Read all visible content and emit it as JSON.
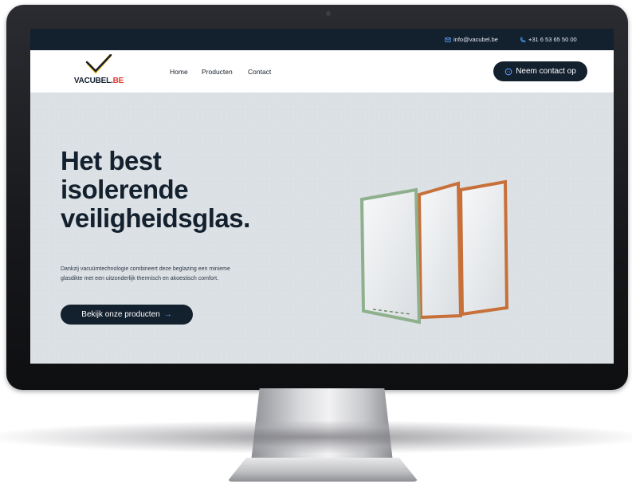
{
  "topbar": {
    "email": "info@vacubel.be",
    "phone": "+31 6 53 65 50 00"
  },
  "nav": {
    "logo_main": "VACUBEL.",
    "logo_accent": "BE",
    "links": [
      "Home",
      "Producten",
      "Contact"
    ],
    "cta_label": "Neem contact op"
  },
  "hero": {
    "title_lines": [
      "Het best",
      "isolerende",
      "veiligheidsglas."
    ],
    "description_lines": [
      "Dankzij vacuümtechnologie combineert deze beglazing een minieme",
      "glasdikte met een uitzonderlijk thermisch en akoestisch comfort."
    ],
    "button_label": "Bekijk onze producten",
    "button_arrow": "→"
  },
  "colors": {
    "navy": "#13202e",
    "logo_accent": "#e03a2f",
    "logo_check_yellow": "#f2b705",
    "hero_bg": "#dce1e5",
    "glass_green": "#8fb08c",
    "glass_copper": "#c8703a"
  },
  "icons": {
    "email": "envelope-icon",
    "phone": "phone-icon",
    "cta": "chat-icon",
    "logo": "checkmark-logo"
  }
}
